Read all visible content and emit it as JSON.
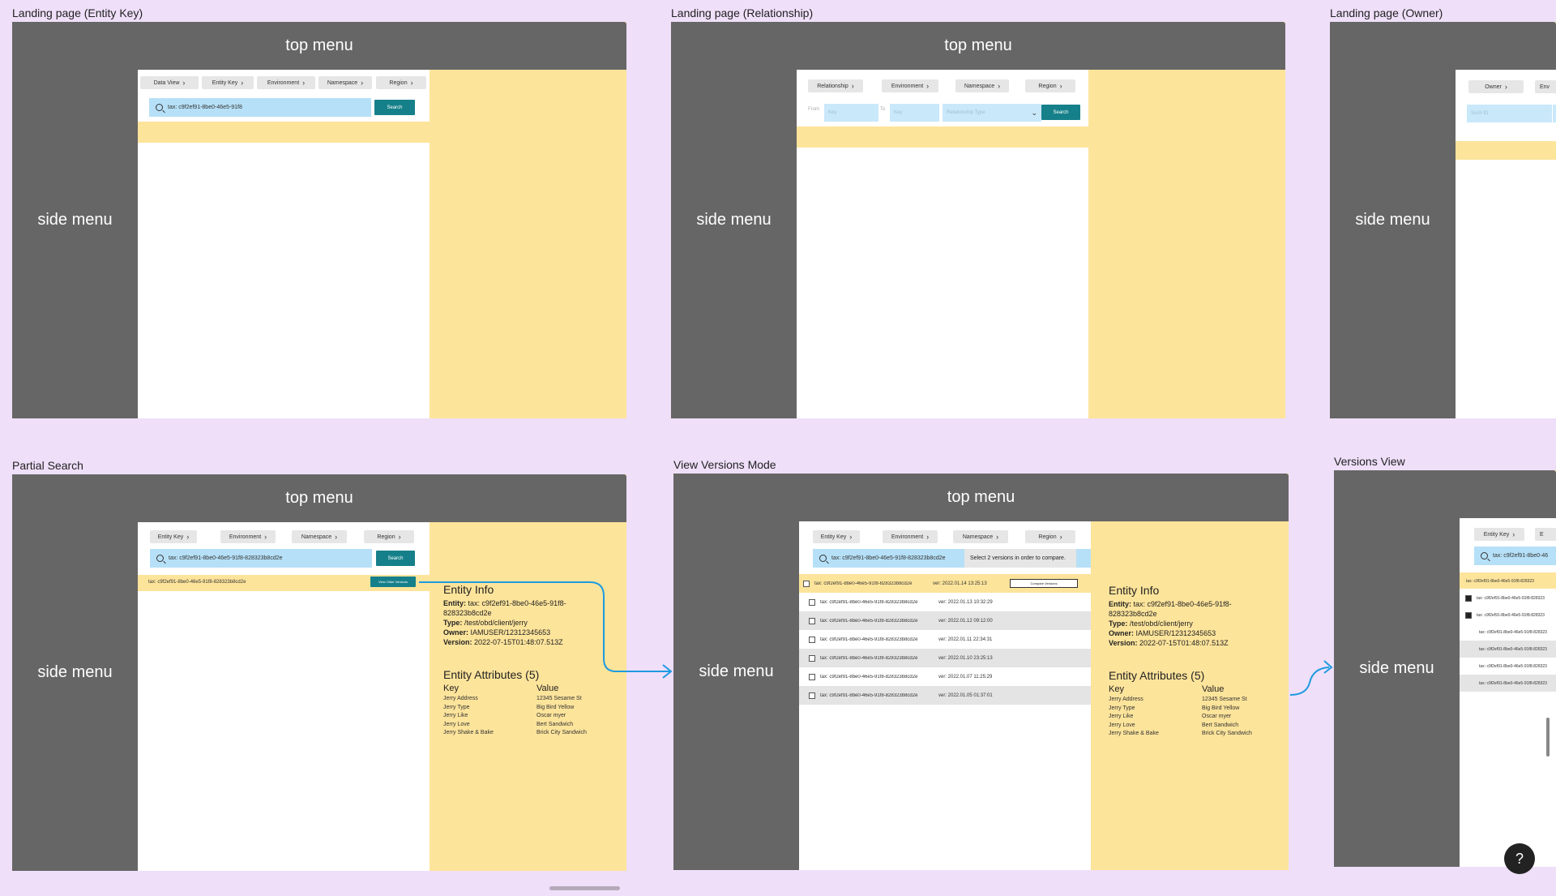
{
  "labels": {
    "top_menu": "top menu",
    "side_menu": "side menu"
  },
  "frames": {
    "entity_key": {
      "title": "Landing page (Entity Key)",
      "chips": [
        "Data View",
        "Entity Key",
        "Environment",
        "Namespace",
        "Region"
      ],
      "search_value": "tax: c9f2ef91-8be0-46e5-91f8",
      "search_button": "Search"
    },
    "relationship": {
      "title": "Landing page (Relationship)",
      "chips": [
        "Relationship",
        "Environment",
        "Namespace",
        "Region"
      ],
      "from_label": "From",
      "from_placeholder": "Key",
      "to_label": "To",
      "to_placeholder": "Key",
      "type_placeholder": "Relationship Type",
      "search_button": "Search"
    },
    "owner": {
      "title": "Landing page (Owner)",
      "chips": [
        "Owner",
        "Env"
      ],
      "search_placeholder": "Such ID"
    },
    "partial_search": {
      "title": "Partial Search",
      "chips": [
        "Entity Key",
        "Environment",
        "Namespace",
        "Region"
      ],
      "search_value": "tax: c9f2ef91-8be0-46e5-91f8-828323b8cd2e",
      "search_button": "Search",
      "result_key": "tax: c9f2ef91-8be0-46e5-91f8-828323b8cd2e",
      "result_button": "View Older Versions"
    },
    "view_versions": {
      "title": "View Versions Mode",
      "chips": [
        "Entity Key",
        "Environment",
        "Namespace",
        "Region"
      ],
      "search_value": "tax: c9f2ef91-8be0-46e5-91f8-828323b8cd2e",
      "tooltip": "Select 2 versions in order to compare.",
      "compare_button": "Compare Versions",
      "rows": [
        {
          "key": "tax: c9f2ef91-8be0-46e5-91f8-828323b8cd2e",
          "version": "ver: 2022.01.14 13:25:13"
        },
        {
          "key": "tax: c9f2ef91-8be0-46e5-91f8-828323b8cd2e",
          "version": "ver: 2022.01.13 10:32:29"
        },
        {
          "key": "tax: c9f2ef91-8be0-46e5-91f8-828323b8cd2e",
          "version": "ver: 2022.01.12 09:12:00"
        },
        {
          "key": "tax: c9f2ef91-8be0-46e5-91f8-828323b8cd2e",
          "version": "ver: 2022.01.11 22:34:31"
        },
        {
          "key": "tax: c9f2ef91-8be0-46e5-91f8-828323b8cd2e",
          "version": "ver: 2022.01.10 23:25:13"
        },
        {
          "key": "tax: c9f2ef91-8be0-46e5-91f8-828323b8cd2e",
          "version": "ver: 2022.01.07 11:25:29"
        },
        {
          "key": "tax: c9f2ef91-8be0-46e5-91f8-828323b8cd2e",
          "version": "ver: 2022.01.05 01:37:01"
        }
      ]
    },
    "versions_view": {
      "title": "Versions View",
      "chips": [
        "Entity Key",
        "E"
      ],
      "search_value": "tax: c9f2ef91-8be0-46",
      "rows": [
        "tax: c9f2ef91-8be0-46e5-91f8-828323",
        "tax: c9f2ef91-8be0-46e5-91f8-828323",
        "tax: c9f2ef91-8be0-46e5-91f8-828323",
        "tax: c9f2ef91-8be0-46e5-91f8-828323",
        "tax: c9f2ef91-8be0-46e5-91f8-828323",
        "tax: c9f2ef91-8be0-46e5-91f8-828323",
        "tax: c9f2ef91-8be0-46e5-91f8-828323"
      ]
    }
  },
  "entity_info": {
    "heading": "Entity Info",
    "entity_label": "Entity:",
    "entity_value": "tax: c9f2ef91-8be0-46e5-91f8-828323b8cd2e",
    "type_label": "Type:",
    "type_value": "/test/obd/client/jerry",
    "owner_label": "Owner:",
    "owner_value": "IAMUSER/12312345653",
    "version_label": "Version:",
    "version_value": "2022-07-15T01:48:07.513Z"
  },
  "entity_attributes": {
    "heading": "Entity Attributes (5)",
    "key_header": "Key",
    "value_header": "Value",
    "rows": [
      {
        "key": "Jerry Address",
        "value": "12345 Sesame St"
      },
      {
        "key": "Jerry Type",
        "value": "Big Bird Yellow"
      },
      {
        "key": "Jerry Like",
        "value": "Oscar myer"
      },
      {
        "key": "Jerry Love",
        "value": "Bert Sandwich"
      },
      {
        "key": "Jerry Shake & Bake",
        "value": "Brick City Sandwich"
      }
    ]
  },
  "help": {
    "icon": "question-icon",
    "glyph": "?"
  },
  "colors": {
    "canvas": "#efdff9",
    "menu": "#666666",
    "panel": "#fde49b",
    "search": "#b6e0f7",
    "button": "#16808a",
    "arrow": "#1e9be0"
  }
}
